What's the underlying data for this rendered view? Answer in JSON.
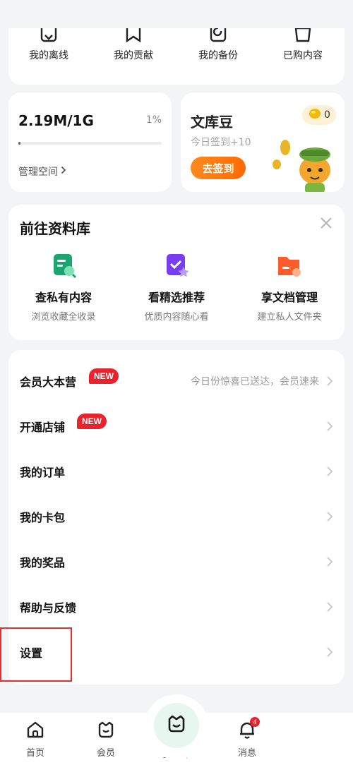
{
  "shortcuts": [
    {
      "label": "我的离线",
      "icon": "offline-icon"
    },
    {
      "label": "我的贡献",
      "icon": "contribution-icon"
    },
    {
      "label": "我的备份",
      "icon": "backup-icon"
    },
    {
      "label": "已购内容",
      "icon": "purchased-icon"
    }
  ],
  "storage": {
    "amount": "2.19M/1G",
    "percent": "1%",
    "usage_fraction": 0.01,
    "manage_label": "管理空间"
  },
  "beans": {
    "title": "文库豆",
    "subtitle": "今日签到+10",
    "button_label": "去签到",
    "count": "0"
  },
  "library": {
    "title": "前往资料库",
    "items": [
      {
        "name": "查私有内容",
        "desc": "浏览收藏全收录",
        "color": "#1aa571"
      },
      {
        "name": "看精选推荐",
        "desc": "优质内容随心看",
        "color": "#7a3cf0"
      },
      {
        "name": "享文档管理",
        "desc": "建立私人文件夹",
        "color": "#ff5a2a"
      }
    ]
  },
  "menu": [
    {
      "label": "会员大本营",
      "badge": "NEW",
      "hint": "今日份惊喜已送达，会员速来"
    },
    {
      "label": "开通店铺",
      "badge": "NEW",
      "hint": ""
    },
    {
      "label": "我的订单",
      "badge": "",
      "hint": ""
    },
    {
      "label": "我的卡包",
      "badge": "",
      "hint": ""
    },
    {
      "label": "我的奖品",
      "badge": "",
      "hint": ""
    },
    {
      "label": "帮助与反馈",
      "badge": "",
      "hint": ""
    },
    {
      "label": "设置",
      "badge": "",
      "hint": ""
    }
  ],
  "nav": {
    "home": "首页",
    "vip": "会员",
    "library": "资料库",
    "messages": "消息",
    "messages_badge": "4"
  },
  "colors": {
    "accent_orange": "#ff6a00",
    "badge_red": "#e8232d",
    "brand_green": "#1aa571"
  }
}
